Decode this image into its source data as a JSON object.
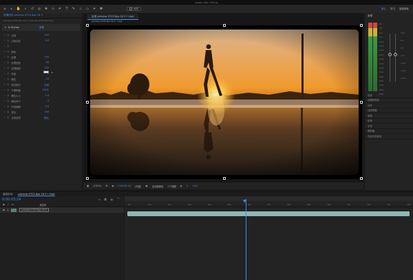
{
  "menubar": {
    "title": "Adobe After Effects"
  },
  "toolbar": {
    "tools": [
      "home-icon",
      "select-icon",
      "hand-icon",
      "zoom-icon",
      "rotate-icon",
      "camera-icon",
      "pan-icon",
      "rect-icon",
      "pen-icon",
      "text-icon",
      "brush-icon",
      "stamp-icon",
      "eraser-icon",
      "roto-icon",
      "puppet-icon"
    ],
    "snap_label": "对齐",
    "workspace_label": "默认",
    "learn_label": "学习",
    "search_label": "搜索帮助"
  },
  "effects_panel": {
    "tab": "效果控件 preview 0703 8ps 16 9",
    "subtitle": "preview 0703 8ps 16 9 • preview 0703 8ps 16 9",
    "effect_name": "fx  Stylize",
    "reset_label": "重置",
    "properties": [
      {
        "label": "边缘",
        "value": "100"
      },
      {
        "label": "边缘羽化",
        "value": "0.0"
      },
      {
        "label": "",
        "value": ""
      },
      {
        "label": "颜色",
        "value": ""
      },
      {
        "label": "纹理",
        "value": "100"
      },
      {
        "label": "纹理密度",
        "value": "50"
      },
      {
        "label": "纹理缩放",
        "value": "200"
      },
      {
        "label": "亮度",
        "value": "0"
      },
      {
        "label": "颗粒",
        "value": "20"
      },
      {
        "label": "混合模式",
        "value": "正常"
      },
      {
        "label": "不透明度",
        "value": "100%"
      },
      {
        "label": "颗粒大小",
        "value": "1.5"
      },
      {
        "label": "随机种子",
        "value": "0"
      },
      {
        "label": "时间偏移",
        "value": "0.0"
      },
      {
        "label": "混合",
        "value": "100"
      },
      {
        "label": "合成选项",
        "value": "默认"
      }
    ]
  },
  "composition": {
    "tab": "合成  preview 0703 8ps 16 9 • high",
    "tab2": "preview 0703 8ps 16 9 • high",
    "footer": {
      "zoom": "(100%)",
      "time": "0:00:03:24",
      "quality": "(完整)",
      "view": "活动摄像机",
      "views": "1个视图",
      "exposure": "+0.0"
    }
  },
  "audio_panel": {
    "title": "音频",
    "db_labels": [
      "0.0",
      "-3.0",
      "-6.0",
      "-9.0",
      "-12.0",
      "-15.0",
      "-18.0",
      "-21.0",
      "-24.0",
      "-27.0",
      "-30.0",
      "-33.0",
      "-36.0",
      "-39.0",
      "-42.0",
      "-45.0",
      "-48.0"
    ],
    "meter_right_labels": [
      "12.0",
      "6.0",
      "0.0",
      "-6.0",
      "-12.0",
      "-18.0",
      "-24.0"
    ],
    "items": [
      "信息",
      "效果和预设",
      "对齐",
      "动态草图",
      "画笔",
      "段落",
      "字符",
      "跟踪器",
      "内容识别填充"
    ]
  },
  "timeline": {
    "tabs": [
      "渲染队列",
      "preview 0703 8ps 16 9 • high"
    ],
    "timecode": "0:00:03:24",
    "layer_header": "源名称",
    "layer_name": "preview 0703 8ps 16 9",
    "ruler_ticks": [
      "0s",
      "01s",
      "02s",
      "03s",
      "04s",
      "05s",
      "06s",
      "07s",
      "08s",
      "09s",
      "10s",
      "11s",
      "12s",
      "13s",
      "14s"
    ]
  }
}
